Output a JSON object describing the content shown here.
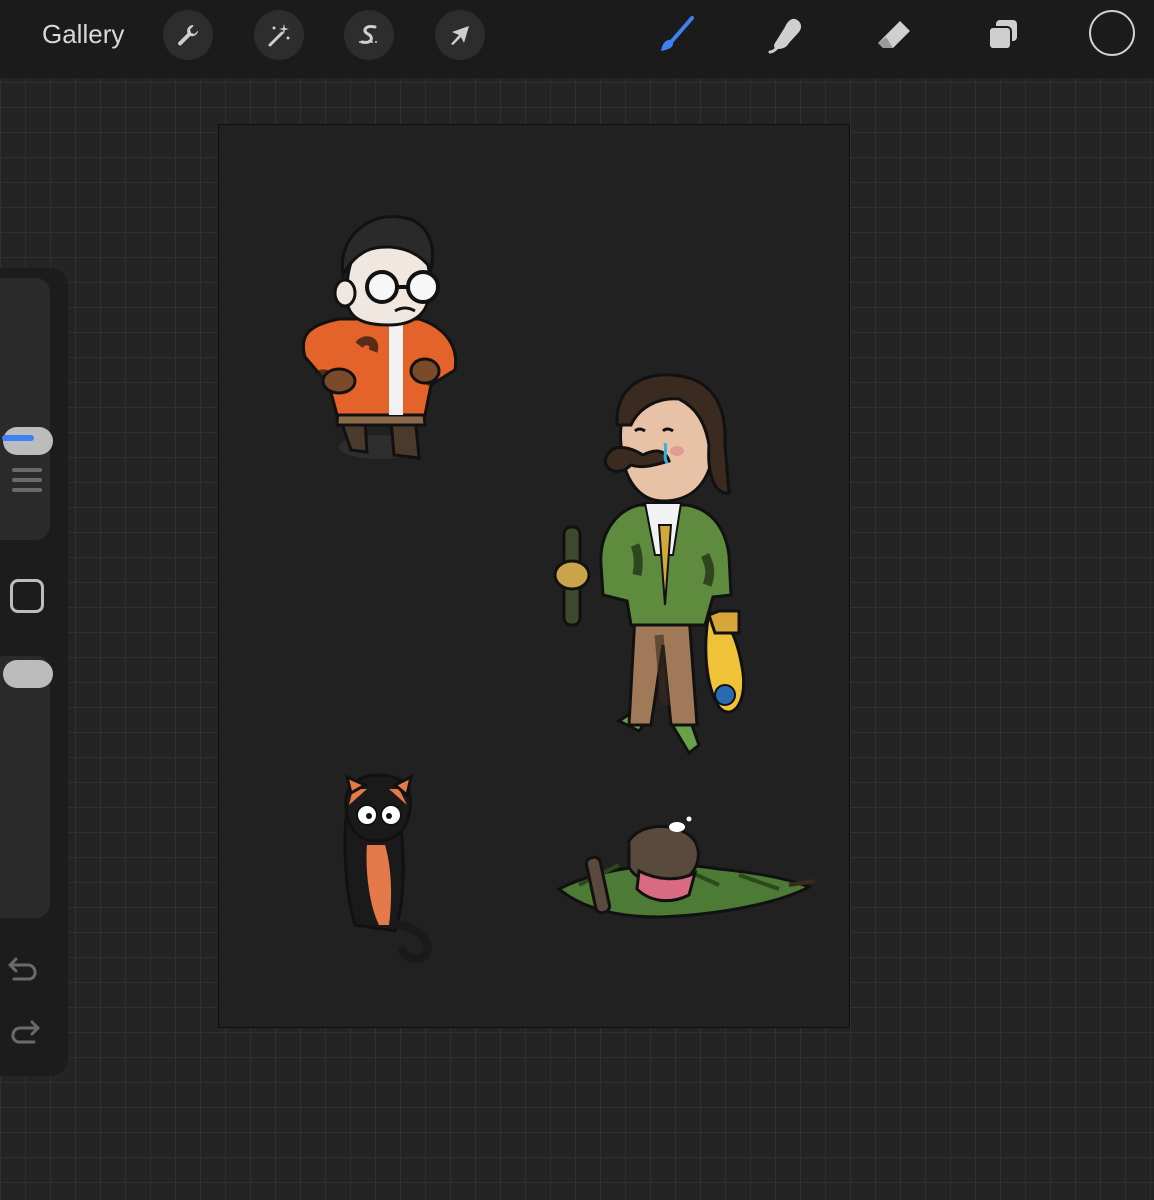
{
  "toolbar": {
    "gallery_label": "Gallery",
    "left_tools": [
      {
        "name": "actions",
        "icon": "wrench-icon"
      },
      {
        "name": "adjustments",
        "icon": "magic-wand-icon"
      },
      {
        "name": "selection",
        "icon": "selection-s-icon"
      },
      {
        "name": "transform",
        "icon": "arrow-cursor-icon"
      }
    ],
    "right_tools": [
      {
        "name": "brush",
        "icon": "brush-icon",
        "active": true
      },
      {
        "name": "smudge",
        "icon": "smudge-finger-icon",
        "active": false
      },
      {
        "name": "eraser",
        "icon": "eraser-icon",
        "active": false
      },
      {
        "name": "layers",
        "icon": "layers-icon",
        "active": false
      }
    ],
    "color": "#1b1b1b"
  },
  "sidebar": {
    "controls": [
      "brush-size-slider",
      "modify-button",
      "opacity-slider",
      "undo-button",
      "redo-button"
    ]
  },
  "canvas": {
    "artwork": [
      "character-orange-jacket",
      "character-green-jacket",
      "black-orange-cat",
      "sleeping-character"
    ]
  },
  "colors": {
    "accent": "#3d82f5",
    "background": "#242424",
    "toolbar": "#1b1b1b"
  }
}
